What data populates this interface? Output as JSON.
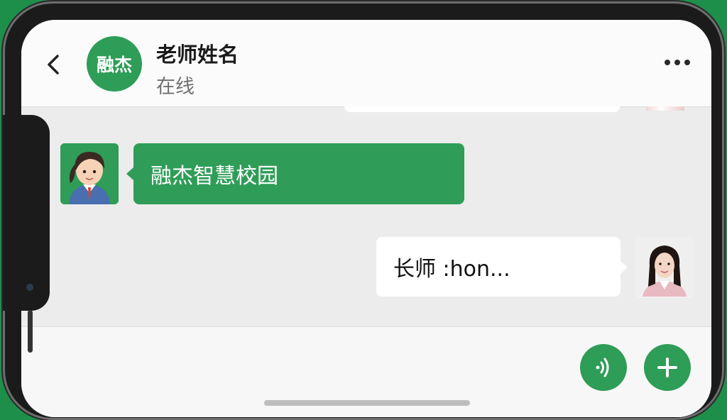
{
  "header": {
    "logo_text": "融杰",
    "contact_name": "老师姓名",
    "status": "在线"
  },
  "messages": [
    {
      "direction": "incoming",
      "sender": "teacher",
      "text": "融杰智慧校园"
    },
    {
      "direction": "outgoing",
      "sender": "student",
      "text": "长师 :hon..."
    }
  ],
  "icons": {
    "back": "chevron-left-icon",
    "more": "more-dots-icon",
    "voice": "voice-wave-icon",
    "add": "plus-icon"
  },
  "colors": {
    "brand_green": "#2e9d57",
    "background": "#ececec",
    "header": "#fbfbfb"
  }
}
